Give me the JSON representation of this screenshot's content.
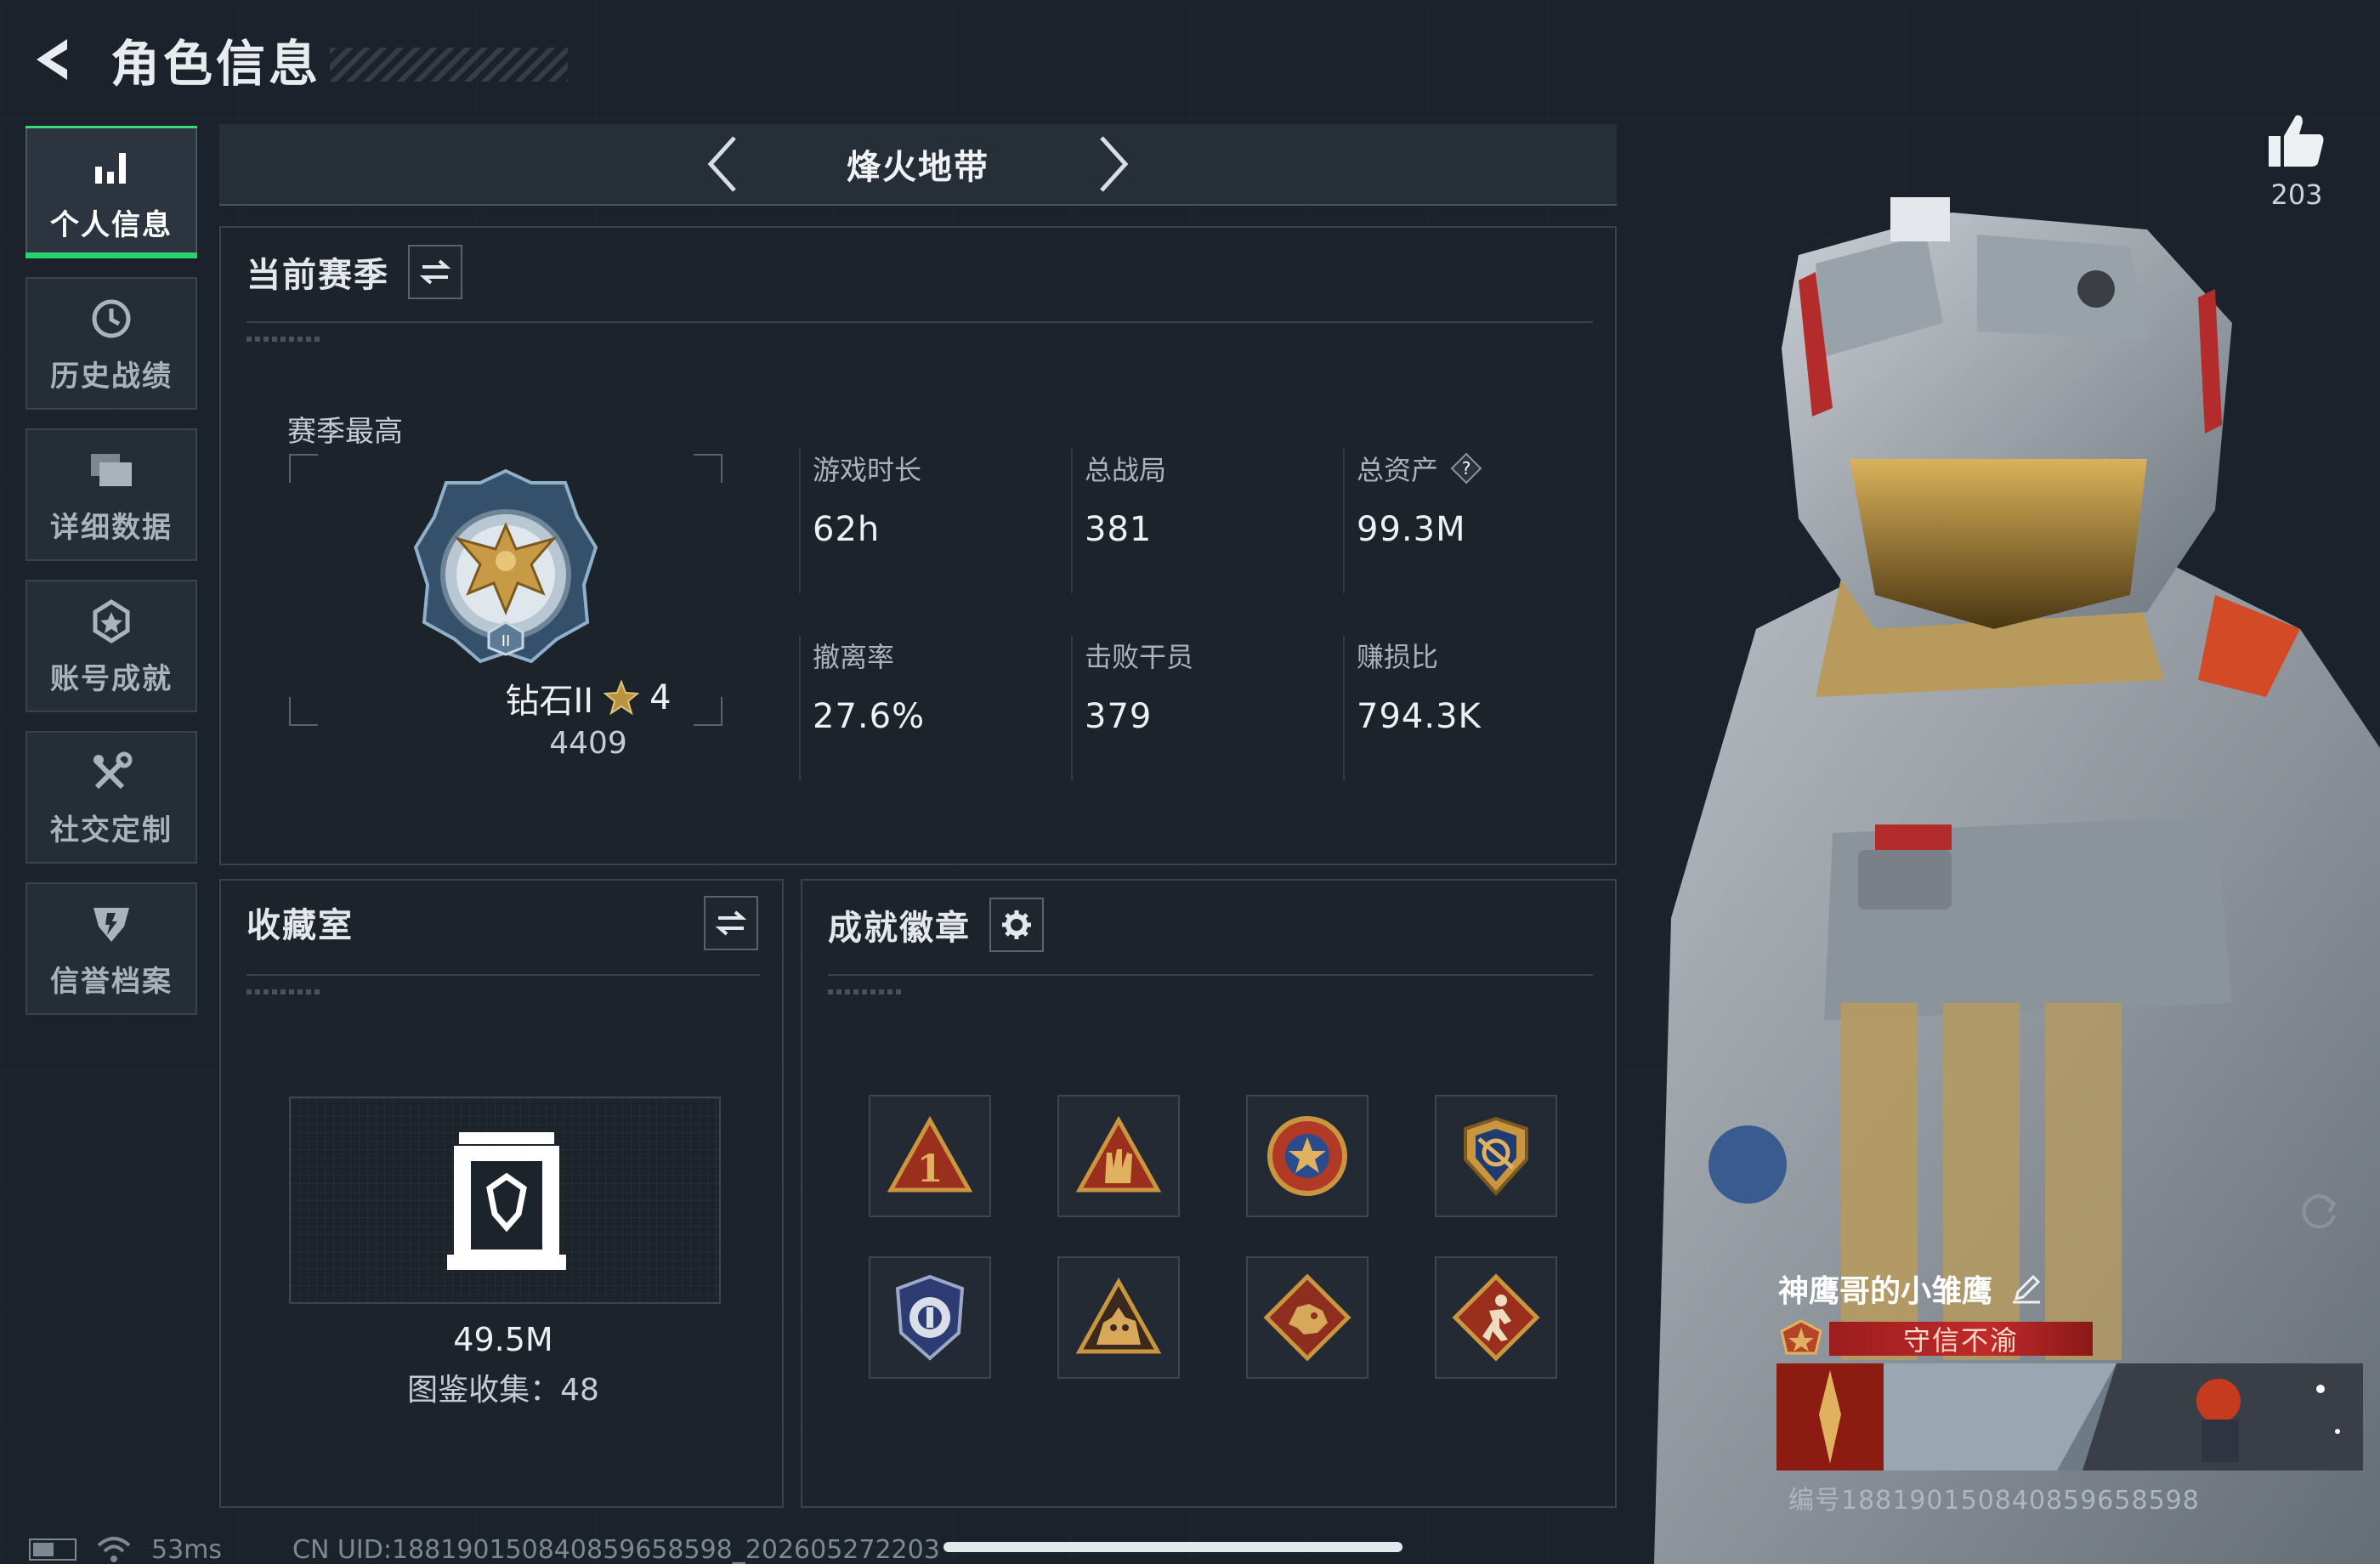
{
  "header": {
    "title": "角色信息"
  },
  "sidebar": {
    "items": [
      {
        "label": "个人信息",
        "icon": "bar-chart-icon",
        "active": true
      },
      {
        "label": "历史战绩",
        "icon": "clock-history-icon",
        "active": false
      },
      {
        "label": "详细数据",
        "icon": "folder-stack-icon",
        "active": false
      },
      {
        "label": "账号成就",
        "icon": "achievement-star-icon",
        "active": false
      },
      {
        "label": "社交定制",
        "icon": "tools-wrench-icon",
        "active": false
      },
      {
        "label": "信誉档案",
        "icon": "reputation-shield-icon",
        "active": false
      }
    ]
  },
  "mode": {
    "name": "烽火地带"
  },
  "season": {
    "title": "当前赛季",
    "best_label": "赛季最高",
    "rank_name": "钻石II",
    "rank_stars": "4",
    "rank_score": "4409",
    "stats": [
      {
        "label": "游戏时长",
        "value": "62h"
      },
      {
        "label": "总战局",
        "value": "381"
      },
      {
        "label": "总资产",
        "value": "99.3M",
        "help": "?"
      },
      {
        "label": "撤离率",
        "value": "27.6%"
      },
      {
        "label": "击败干员",
        "value": "379"
      },
      {
        "label": "赚损比",
        "value": "794.3K"
      }
    ]
  },
  "collection": {
    "title": "收藏室",
    "value": "49.5M",
    "count_text": "图鉴收集：48"
  },
  "achievements": {
    "title": "成就徽章",
    "badges": [
      {
        "icon": "rank-one-triangle-badge-icon"
      },
      {
        "icon": "rock-hand-triangle-badge-icon"
      },
      {
        "icon": "star-crest-badge-icon"
      },
      {
        "icon": "gold-shield-crest-badge-icon"
      },
      {
        "icon": "blue-police-badge-icon"
      },
      {
        "icon": "beast-triangle-badge-icon"
      },
      {
        "icon": "dragon-diamond-badge-icon"
      },
      {
        "icon": "runner-diamond-badge-icon"
      }
    ]
  },
  "profile": {
    "likes": "203",
    "player_name": "神鹰哥的小雏鹰",
    "tag": "守信不渝",
    "player_id": "编号1881901508408596585​98"
  },
  "status": {
    "ping": "53ms",
    "uid": "CN UID:1881901508408596585​98_20260527220​3"
  },
  "colors": {
    "accent_green": "#27d36f",
    "tag_red": "#c02a2a",
    "badge_gold": "#c9953e"
  }
}
